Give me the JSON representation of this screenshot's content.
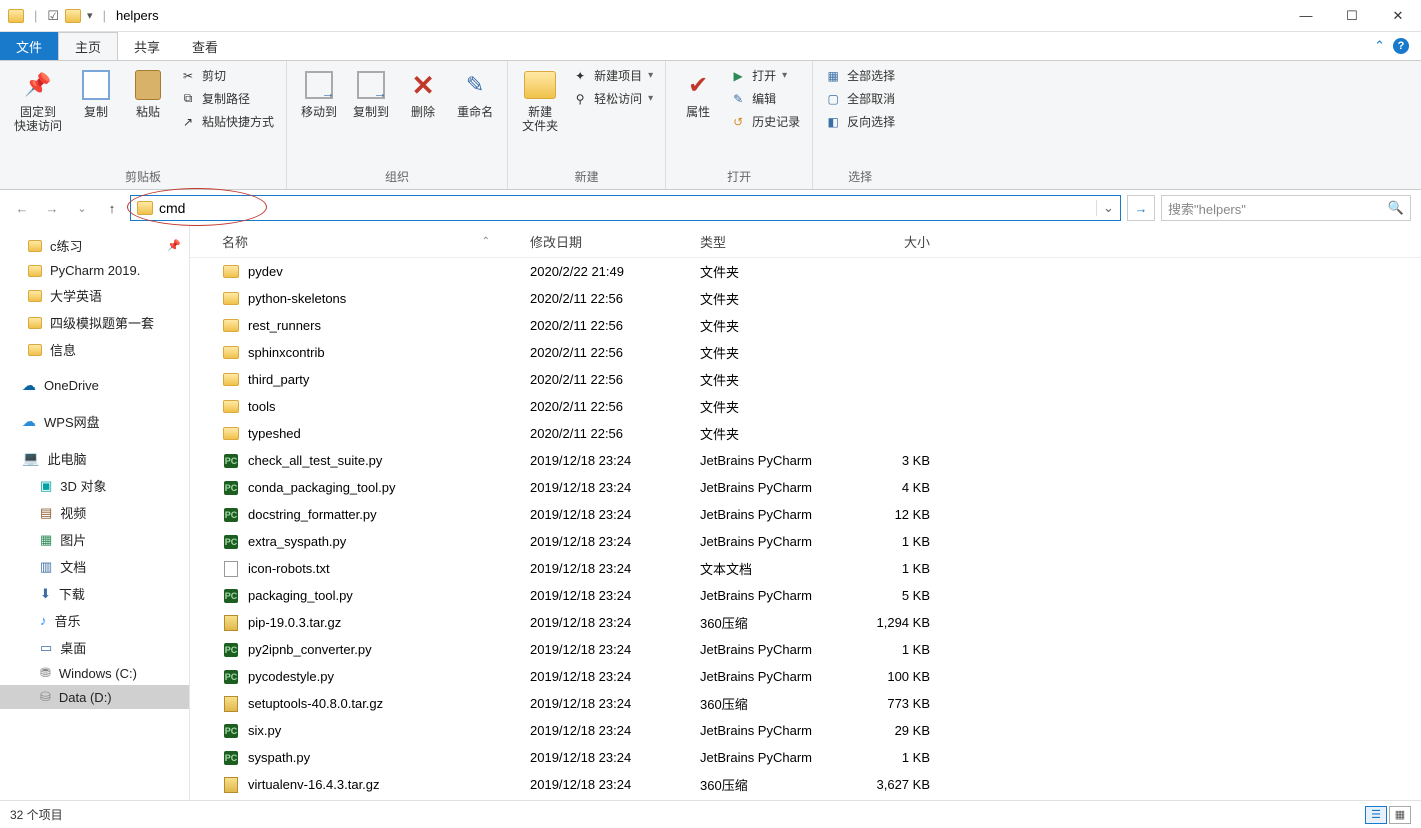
{
  "title": "helpers",
  "tabs": {
    "file": "文件",
    "home": "主页",
    "share": "共享",
    "view": "查看"
  },
  "ribbon": {
    "clipboard": {
      "label": "剪贴板",
      "pin": "固定到\n快速访问",
      "copy": "复制",
      "paste": "粘贴",
      "cut": "剪切",
      "copypath": "复制路径",
      "pasteshortcut": "粘贴快捷方式"
    },
    "organize": {
      "label": "组织",
      "moveto": "移动到",
      "copyto": "复制到",
      "delete": "删除",
      "rename": "重命名"
    },
    "new": {
      "label": "新建",
      "newfolder": "新建\n文件夹",
      "newitem": "新建项目",
      "easyaccess": "轻松访问"
    },
    "open": {
      "label": "打开",
      "properties": "属性",
      "open": "打开",
      "edit": "编辑",
      "history": "历史记录"
    },
    "select": {
      "label": "选择",
      "all": "全部选择",
      "none": "全部取消",
      "invert": "反向选择"
    }
  },
  "address_value": "cmd",
  "search_placeholder": "搜索\"helpers\"",
  "columns": {
    "name": "名称",
    "date": "修改日期",
    "type": "类型",
    "size": "大小"
  },
  "sidebar": {
    "quick": [
      {
        "label": "c练习",
        "pinned": true
      },
      {
        "label": "PyCharm 2019."
      },
      {
        "label": "大学英语"
      },
      {
        "label": "四级模拟题第一套"
      },
      {
        "label": "信息"
      }
    ],
    "onedrive": "OneDrive",
    "wps": "WPS网盘",
    "thispc": "此电脑",
    "pcitems": [
      {
        "label": "3D 对象",
        "cls": "i-3d",
        "glyph": "▣"
      },
      {
        "label": "视频",
        "cls": "i-video",
        "glyph": "▤"
      },
      {
        "label": "图片",
        "cls": "i-pic",
        "glyph": "▦"
      },
      {
        "label": "文档",
        "cls": "i-doc",
        "glyph": "▥"
      },
      {
        "label": "下载",
        "cls": "i-dl",
        "glyph": "⬇"
      },
      {
        "label": "音乐",
        "cls": "i-music",
        "glyph": "♪"
      },
      {
        "label": "桌面",
        "cls": "i-desk",
        "glyph": "▭"
      },
      {
        "label": "Windows (C:)",
        "cls": "i-drive",
        "glyph": "⛃"
      },
      {
        "label": "Data (D:)",
        "cls": "i-drive",
        "glyph": "⛁",
        "selected": true
      }
    ]
  },
  "files": [
    {
      "icon": "folder",
      "name": "pydev",
      "date": "2020/2/22 21:49",
      "type": "文件夹",
      "size": ""
    },
    {
      "icon": "folder",
      "name": "python-skeletons",
      "date": "2020/2/11 22:56",
      "type": "文件夹",
      "size": ""
    },
    {
      "icon": "folder",
      "name": "rest_runners",
      "date": "2020/2/11 22:56",
      "type": "文件夹",
      "size": ""
    },
    {
      "icon": "folder",
      "name": "sphinxcontrib",
      "date": "2020/2/11 22:56",
      "type": "文件夹",
      "size": ""
    },
    {
      "icon": "folder",
      "name": "third_party",
      "date": "2020/2/11 22:56",
      "type": "文件夹",
      "size": ""
    },
    {
      "icon": "folder",
      "name": "tools",
      "date": "2020/2/11 22:56",
      "type": "文件夹",
      "size": ""
    },
    {
      "icon": "folder",
      "name": "typeshed",
      "date": "2020/2/11 22:56",
      "type": "文件夹",
      "size": ""
    },
    {
      "icon": "py",
      "name": "check_all_test_suite.py",
      "date": "2019/12/18 23:24",
      "type": "JetBrains PyCharm",
      "size": "3 KB"
    },
    {
      "icon": "py",
      "name": "conda_packaging_tool.py",
      "date": "2019/12/18 23:24",
      "type": "JetBrains PyCharm",
      "size": "4 KB"
    },
    {
      "icon": "py",
      "name": "docstring_formatter.py",
      "date": "2019/12/18 23:24",
      "type": "JetBrains PyCharm",
      "size": "12 KB"
    },
    {
      "icon": "py",
      "name": "extra_syspath.py",
      "date": "2019/12/18 23:24",
      "type": "JetBrains PyCharm",
      "size": "1 KB"
    },
    {
      "icon": "txt",
      "name": "icon-robots.txt",
      "date": "2019/12/18 23:24",
      "type": "文本文档",
      "size": "1 KB"
    },
    {
      "icon": "py",
      "name": "packaging_tool.py",
      "date": "2019/12/18 23:24",
      "type": "JetBrains PyCharm",
      "size": "5 KB"
    },
    {
      "icon": "gz",
      "name": "pip-19.0.3.tar.gz",
      "date": "2019/12/18 23:24",
      "type": "360压缩",
      "size": "1,294 KB"
    },
    {
      "icon": "py",
      "name": "py2ipnb_converter.py",
      "date": "2019/12/18 23:24",
      "type": "JetBrains PyCharm",
      "size": "1 KB"
    },
    {
      "icon": "py",
      "name": "pycodestyle.py",
      "date": "2019/12/18 23:24",
      "type": "JetBrains PyCharm",
      "size": "100 KB"
    },
    {
      "icon": "gz",
      "name": "setuptools-40.8.0.tar.gz",
      "date": "2019/12/18 23:24",
      "type": "360压缩",
      "size": "773 KB"
    },
    {
      "icon": "py",
      "name": "six.py",
      "date": "2019/12/18 23:24",
      "type": "JetBrains PyCharm",
      "size": "29 KB"
    },
    {
      "icon": "py",
      "name": "syspath.py",
      "date": "2019/12/18 23:24",
      "type": "JetBrains PyCharm",
      "size": "1 KB"
    },
    {
      "icon": "gz",
      "name": "virtualenv-16.4.3.tar.gz",
      "date": "2019/12/18 23:24",
      "type": "360压缩",
      "size": "3,627 KB"
    }
  ],
  "status": "32 个项目"
}
